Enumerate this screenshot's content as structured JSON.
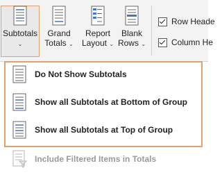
{
  "ribbon": {
    "subtotals": {
      "label": "Subtotals",
      "chevron": "⌄"
    },
    "grand_totals": {
      "line1": "Grand",
      "line2": "Totals",
      "chevron": "⌄"
    },
    "report_layout": {
      "line1": "Report",
      "line2": "Layout",
      "chevron": "⌄"
    },
    "blank_rows": {
      "line1": "Blank",
      "line2": "Rows",
      "chevron": "⌄"
    },
    "row_headers": {
      "label": "Row Heade"
    },
    "column_headers": {
      "label": "Column He"
    }
  },
  "menu": {
    "items": [
      {
        "label": "Do Not Show Subtotals",
        "icon": "subtotals-none-icon"
      },
      {
        "label": "Show all Subtotals at Bottom of Group",
        "icon": "subtotals-bottom-icon"
      },
      {
        "label": "Show all Subtotals at Top of Group",
        "icon": "subtotals-top-icon"
      }
    ],
    "filtered_item": {
      "label": "Include Filtered Items in Totals",
      "icon": "filtered-totals-icon"
    }
  },
  "colors": {
    "accent": "#e3a06e",
    "icon_blue": "#4472c4"
  }
}
